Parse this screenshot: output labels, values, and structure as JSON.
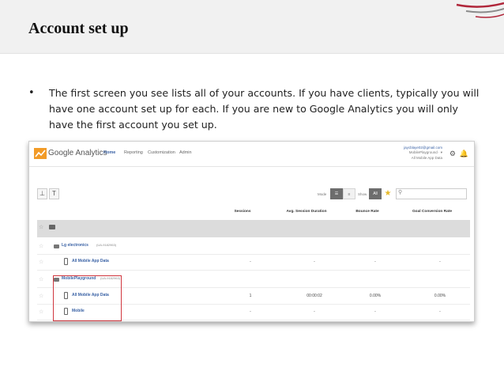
{
  "slide": {
    "title": "Account set up",
    "bullet": "•",
    "body": "The first screen you see lists all of your accounts. If you have clients, typically you will have one account set up for each. If you are new to Google Analytics you will only have the first account you set up."
  },
  "ga": {
    "brand": "Google Analytics",
    "nav": [
      "Home",
      "Reporting",
      "Customization",
      "Admin"
    ],
    "active_nav": "Home",
    "user_email": "jaycblaye02@gmail.com",
    "account_switch": "MobilePlayground · ▾",
    "view_name": "All Mobile App Data",
    "toolbar": {
      "mode_label": "Mode",
      "show_label": "Show",
      "show_all": "All",
      "search_placeholder": ""
    },
    "columns": [
      "Sessions",
      "Avg. Session Duration",
      "Bounce Rate",
      "Goal Conversion Rate"
    ],
    "rows": [
      {
        "kind": "account",
        "name": "Lg electronics",
        "id": "(UA-9182963)",
        "values": []
      },
      {
        "kind": "view",
        "name": "All Mobile App Data",
        "id": "",
        "values": [
          "-",
          "-",
          "-",
          "-"
        ]
      },
      {
        "kind": "account",
        "name": "MobilePlayground",
        "id": "(UA-9182963)",
        "values": []
      },
      {
        "kind": "view",
        "name": "All Mobile App Data",
        "id": "",
        "values": [
          "1",
          "00:00:02",
          "0.00%",
          "0.00%"
        ]
      },
      {
        "kind": "view",
        "name": "Mobile",
        "id": "",
        "values": [
          "-",
          "-",
          "-",
          "-"
        ]
      }
    ]
  },
  "colors": {
    "accent_red": "#b0263a",
    "link_blue": "#3a62a5",
    "highlight": "#d0363e"
  }
}
